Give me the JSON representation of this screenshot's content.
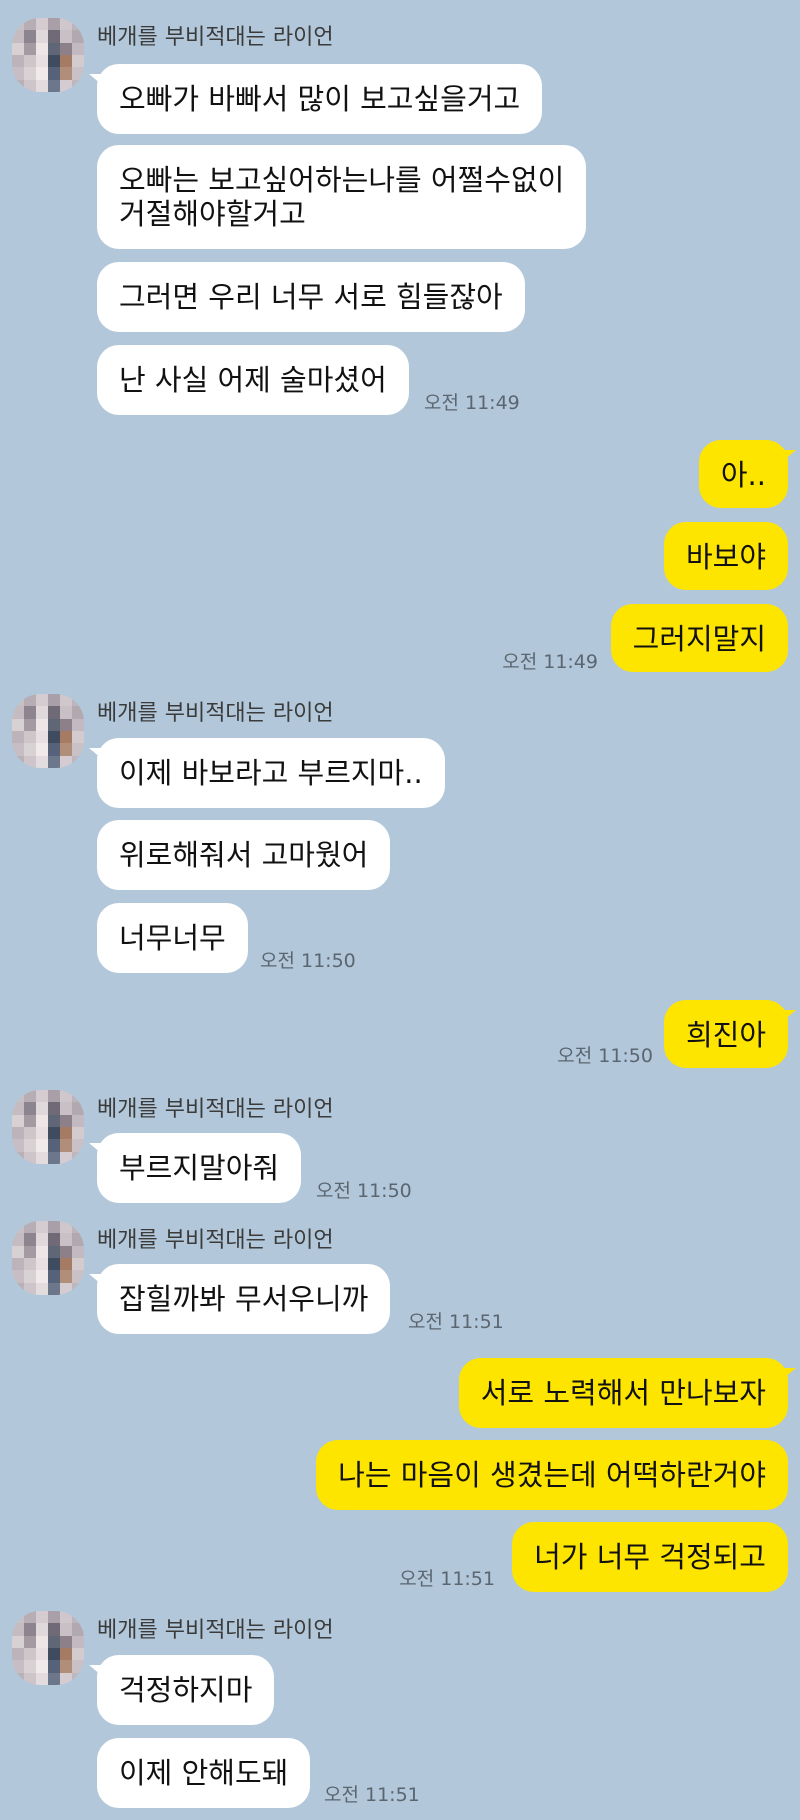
{
  "sender_name": "베개를 부비적대는 라이언",
  "messages": [
    {
      "text": "오빠가 바빠서 많이 보고싶을거고"
    },
    {
      "text": "오빠는 보고싶어하는나를 어쩔수없이",
      "text2": "거절해야할거고"
    },
    {
      "text": "그러면 우리 너무 서로 힘들잖아"
    },
    {
      "text": "난 사실 어제 술마셨어",
      "time": "오전 11:49"
    },
    {
      "text": "아.."
    },
    {
      "text": "바보야"
    },
    {
      "text": "그러지말지",
      "time": "오전 11:49"
    },
    {
      "text": "이제 바보라고 부르지마.."
    },
    {
      "text": "위로해줘서 고마웠어"
    },
    {
      "text": "너무너무",
      "time": "오전 11:50"
    },
    {
      "text": "희진아",
      "time": "오전 11:50"
    },
    {
      "text": "부르지말아줘",
      "time": "오전 11:50"
    },
    {
      "text": "잡힐까봐 무서우니까",
      "time": "오전 11:51"
    },
    {
      "text": "서로 노력해서 만나보자"
    },
    {
      "text": "나는 마음이 생겼는데 어떡하란거야"
    },
    {
      "text": "너가 너무 걱정되고",
      "time": "오전 11:51"
    },
    {
      "text": "걱정하지마"
    },
    {
      "text": "이제 안해도돼",
      "time": "오전 11:51"
    }
  ],
  "colors": {
    "background": "#b2c7da",
    "incoming_bubble": "#ffffff",
    "outgoing_bubble": "#fee500"
  }
}
